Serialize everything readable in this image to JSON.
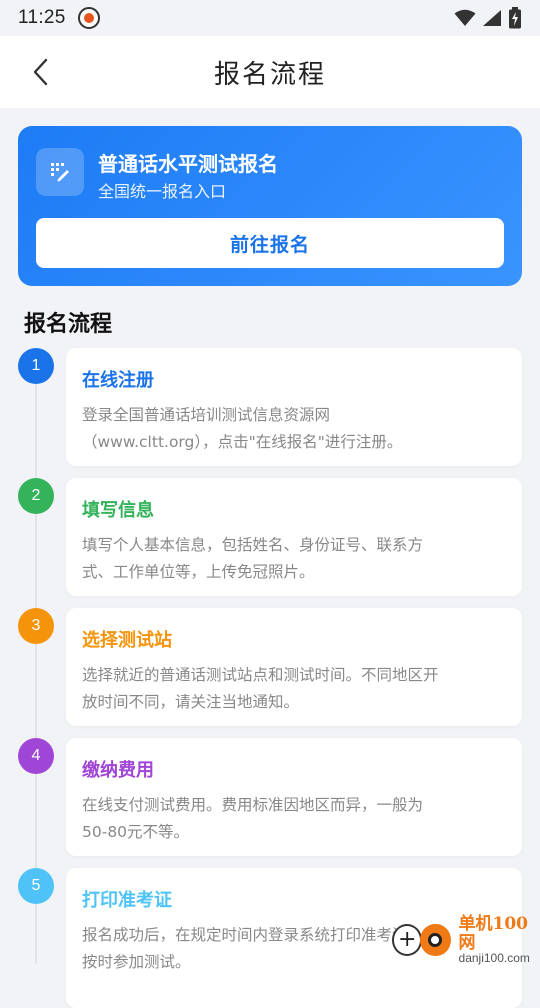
{
  "status_bar": {
    "time": "11:25"
  },
  "header": {
    "title": "报名流程"
  },
  "banner": {
    "title": "普通话水平测试报名",
    "subtitle": "全国统一报名入口",
    "button_label": "前往报名"
  },
  "section": {
    "title": "报名流程"
  },
  "steps": [
    {
      "number": "1",
      "title": "在线注册",
      "desc1": "登录全国普通话培训测试信息资源网",
      "desc2": "（www.cltt.org），点击\"在线报名\"进行注册。",
      "color": "#1a73e8"
    },
    {
      "number": "2",
      "title": "填写信息",
      "desc1": "填写个人基本信息，包括姓名、身份证号、联系方",
      "desc2": "式、工作单位等，上传免冠照片。",
      "color": "#34b35a"
    },
    {
      "number": "3",
      "title": "选择测试站",
      "desc1": "选择就近的普通话测试站点和测试时间。不同地区开",
      "desc2": "放时间不同，请关注当地通知。",
      "color": "#f5930b"
    },
    {
      "number": "4",
      "title": "缴纳费用",
      "desc1": "在线支付测试费用。费用标准因地区而异，一般为",
      "desc2": "50-80元不等。",
      "color": "#a046d6"
    },
    {
      "number": "5",
      "title": "打印准考证",
      "desc1": "报名成功后，在规定时间内登录系统打印准考证，并",
      "desc2": "按时参加测试。",
      "color": "#4fc3f7"
    }
  ],
  "watermark": {
    "line1": "单机100网",
    "line2": "danji100.com"
  }
}
